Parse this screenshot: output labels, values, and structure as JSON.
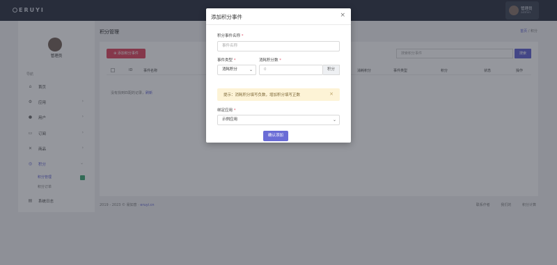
{
  "topbar": {
    "logo": "ERUYI",
    "user_name": "管理员",
    "user_role": "admin"
  },
  "sidebar": {
    "user_name": "管理员",
    "section_label": "导航",
    "items": [
      {
        "label": "首页",
        "icon": "home-icon"
      },
      {
        "label": "应用",
        "icon": "gear-icon"
      },
      {
        "label": "用户",
        "icon": "user-icon"
      },
      {
        "label": "订阅",
        "icon": "cart-icon"
      },
      {
        "label": "商品",
        "icon": "tag-icon"
      },
      {
        "label": "积分",
        "icon": "coin-icon"
      },
      {
        "label": "系统日志",
        "icon": "log-icon"
      }
    ],
    "sub_items": [
      {
        "label": "积分管理"
      },
      {
        "label": "积分订单"
      }
    ]
  },
  "main": {
    "title": "积分管理",
    "breadcrumb": {
      "home": "首页",
      "current": "积分"
    },
    "add_button": "添加积分事件",
    "search_placeholder": "搜索积分事件",
    "search_button": "搜索",
    "table_headers": [
      "ID",
      "事件名称",
      "消耗积分",
      "事件类型",
      "积分",
      "状态",
      "操作"
    ],
    "empty_text": "没有找到匹配的记录",
    "empty_link": "刷新"
  },
  "footer": {
    "copyright": "2019 - 2023 © 易如意",
    "link": "eruyi.cn",
    "links": [
      "联系作者",
      "我们的",
      "积分计算"
    ]
  },
  "modal": {
    "title": "添加积分事件",
    "close": "×",
    "name_label": "积分事件名称",
    "name_placeholder": "事件名称",
    "type_label": "事件类型",
    "type_value": "消耗积分",
    "points_label": "消耗积分数",
    "points_placeholder": "0",
    "points_addon": "积分",
    "alert_text": "提示：消耗积分填写负数，增加积分填写正数",
    "alert_close": "×",
    "app_label": "绑定应用",
    "app_value": "示例应用",
    "confirm_button": "确认添加",
    "required_mark": "*"
  },
  "colors": {
    "primary": "#6a6cd6",
    "danger": "#e2536a",
    "topbar": "#3a3f4d",
    "alert_bg": "#fdf3d6"
  }
}
